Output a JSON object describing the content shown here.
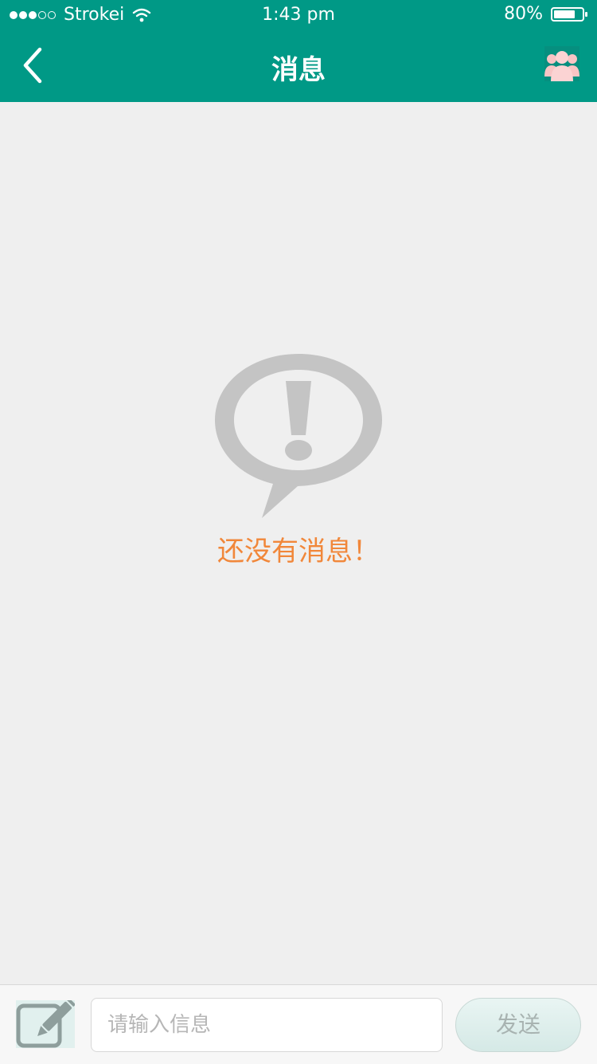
{
  "status_bar": {
    "carrier": "Strokei",
    "time": "1:43 pm",
    "battery": "80%",
    "battery_level": 0.8,
    "signal_bars_filled": 3,
    "signal_bars_total": 5
  },
  "nav": {
    "title": "消息",
    "back_icon": "chevron-left-icon",
    "right_icon": "group-icon"
  },
  "empty_state": {
    "icon": "alert-speech-bubble-icon",
    "message": "还没有消息！"
  },
  "composer": {
    "edit_icon": "pencil-icon",
    "input_placeholder": "请输入信息",
    "input_value": "",
    "send_label": "发送"
  },
  "colors": {
    "header": "#009986",
    "background": "#efefef",
    "empty_text": "#f1873a",
    "input_border": "#d8d8d8",
    "placeholder": "#b6b6b6"
  }
}
